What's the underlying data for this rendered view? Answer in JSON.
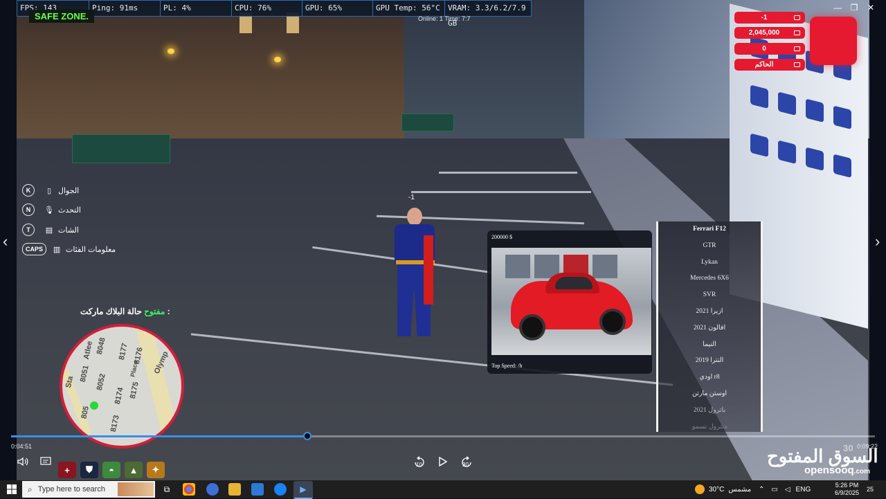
{
  "window": {
    "minimize": "—",
    "maximize": "❐",
    "close": "✕"
  },
  "perf": {
    "fps": "FPS: 143",
    "ping": "Ping: 91ms",
    "pl": "PL: 4%",
    "cpu": "CPU: 76%",
    "gpu": "GPU: 65%",
    "gpu_temp": "GPU Temp: 56°C",
    "vram": "VRAM: 3.3/6.2/7.9 GB"
  },
  "safe_zone": "SAFE ZONE.",
  "online": "Online: 1 Time: 7:7",
  "player_id": "-1",
  "money": {
    "rows": [
      {
        "value": "-1",
        "icon": "id-card-icon"
      },
      {
        "value": "2,045,000",
        "icon": "bank-icon"
      },
      {
        "value": "0",
        "icon": "wallet-icon"
      },
      {
        "value": "الحاكم",
        "icon": "job-briefcase-icon"
      }
    ],
    "color": "#e5192f"
  },
  "keys": [
    {
      "key": "K",
      "label": "الجوال",
      "icon": "phone-icon"
    },
    {
      "key": "N",
      "label": "التحدث",
      "icon": "microphone-icon"
    },
    {
      "key": "T",
      "label": "الشات",
      "icon": "chat-icon"
    },
    {
      "key": "CAPS",
      "label": "معلومات الفئات",
      "icon": "chart-icon"
    }
  ],
  "black_market": {
    "label": "حالة البلاك ماركت :",
    "status": "مفتوح"
  },
  "minimap": {
    "streets": [
      "Olymp",
      "Atlee",
      "Sta",
      "Place"
    ],
    "numbers": [
      "8051",
      "8048",
      "8177",
      "8176",
      "8052",
      "8174",
      "8175",
      "8173",
      "805"
    ]
  },
  "vehicle": {
    "price": "200000 $",
    "top_speed": "Top Speed: /h",
    "list": [
      "Ferrari F12",
      "GTR",
      "Lykan",
      "Mercedes 6X6",
      "SVR",
      "ازيرا 2021",
      "افالون 2021",
      "النيما",
      "النترا 2019",
      "اودي r8",
      "اوستن مارتن",
      "باترول 2021",
      "دنترول نسمو"
    ],
    "selected": 0
  },
  "video": {
    "current_time": "0:04:51",
    "duration": "0:09:22",
    "progress": 0.343,
    "overlay_number": "30",
    "rewind_label": "10",
    "forward_label": "30"
  },
  "hud_buttons": [
    {
      "name": "health-plus-icon",
      "glyph": "+",
      "color": "#8a1520"
    },
    {
      "name": "armor-shield-icon",
      "glyph": "⛊",
      "color": "#1b2640"
    },
    {
      "name": "food-icon",
      "glyph": "◓",
      "color": "#3d8a3a"
    },
    {
      "name": "water-drop-icon",
      "glyph": "▲",
      "color": "#4d6a32"
    },
    {
      "name": "stamina-run-icon",
      "glyph": "✦",
      "color": "#b7791a"
    }
  ],
  "logo": {
    "arabic": "السوق المفتوح",
    "latin": "opensooq",
    "tld": ".com"
  },
  "taskbar": {
    "search_placeholder": "Type here to search",
    "weather_temp": "30°C",
    "weather_label": "مشمس",
    "lang": "ENG",
    "time": "5:26 PM",
    "date": "6/9/2025",
    "notif_count": "25"
  }
}
